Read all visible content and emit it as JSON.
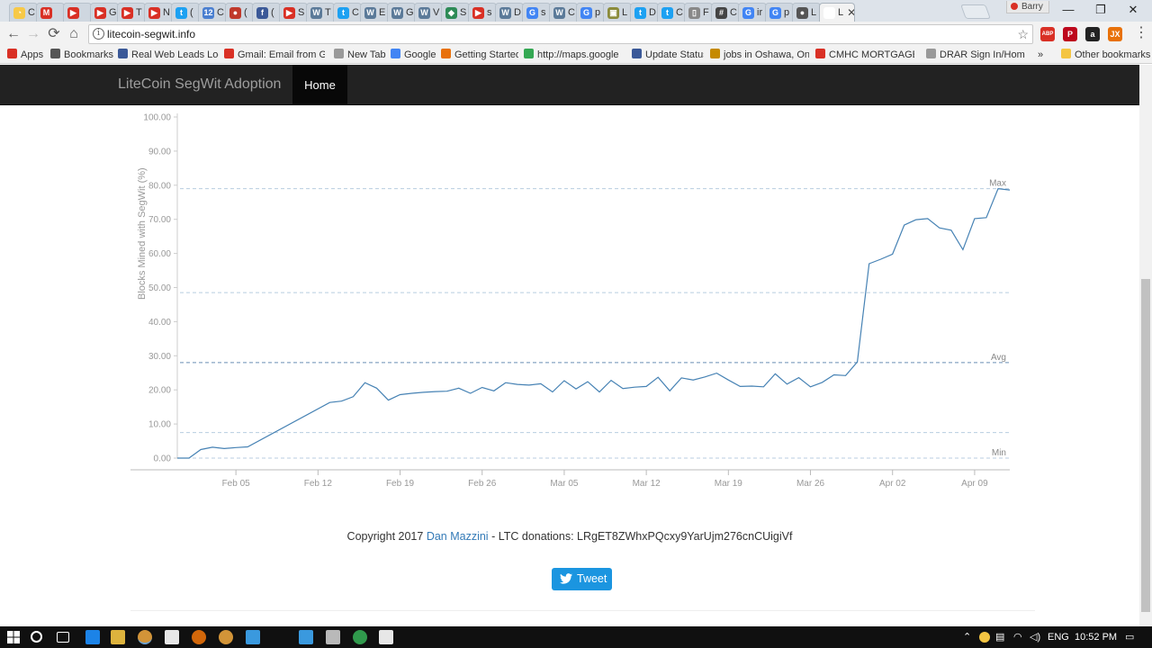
{
  "browser": {
    "tabs": [
      {
        "label": "C",
        "fav": "#f7c948",
        "glyph": "◔"
      },
      {
        "label": "",
        "fav": "#d93025",
        "glyph": "M"
      },
      {
        "label": "",
        "fav": "#d93025",
        "glyph": "▶"
      },
      {
        "label": "G",
        "fav": "#d93025",
        "glyph": "▶"
      },
      {
        "label": "T",
        "fav": "#d93025",
        "glyph": "▶"
      },
      {
        "label": "N",
        "fav": "#d93025",
        "glyph": "▶"
      },
      {
        "label": "(",
        "fav": "#1da1f2",
        "glyph": "t"
      },
      {
        "label": "C",
        "fav": "#4a7fd0",
        "glyph": "12"
      },
      {
        "label": "(",
        "fav": "#c0392b",
        "glyph": "●"
      },
      {
        "label": "(",
        "fav": "#3b5998",
        "glyph": "f"
      },
      {
        "label": "S",
        "fav": "#d93025",
        "glyph": "▶"
      },
      {
        "label": "T",
        "fav": "#5b7a99",
        "glyph": "W"
      },
      {
        "label": "C",
        "fav": "#1da1f2",
        "glyph": "t"
      },
      {
        "label": "E",
        "fav": "#5b7a99",
        "glyph": "W"
      },
      {
        "label": "G",
        "fav": "#5b7a99",
        "glyph": "W"
      },
      {
        "label": "V",
        "fav": "#5b7a99",
        "glyph": "W"
      },
      {
        "label": "S",
        "fav": "#2e8b57",
        "glyph": "◆"
      },
      {
        "label": "s",
        "fav": "#d93025",
        "glyph": "▶"
      },
      {
        "label": "D",
        "fav": "#5b7a99",
        "glyph": "W"
      },
      {
        "label": "s",
        "fav": "#4285f4",
        "glyph": "G"
      },
      {
        "label": "C",
        "fav": "#5b7a99",
        "glyph": "W"
      },
      {
        "label": "p",
        "fav": "#4285f4",
        "glyph": "G"
      },
      {
        "label": "L",
        "fav": "#8b8b3a",
        "glyph": "▣"
      },
      {
        "label": "D",
        "fav": "#1da1f2",
        "glyph": "t"
      },
      {
        "label": "C",
        "fav": "#1da1f2",
        "glyph": "t"
      },
      {
        "label": "F",
        "fav": "#888888",
        "glyph": "▯"
      },
      {
        "label": "C",
        "fav": "#444444",
        "glyph": "#"
      },
      {
        "label": "ir",
        "fav": "#4285f4",
        "glyph": "G"
      },
      {
        "label": "p",
        "fav": "#4285f4",
        "glyph": "G"
      },
      {
        "label": "L",
        "fav": "#555555",
        "glyph": "●"
      },
      {
        "label": "L",
        "fav": "#ffffff",
        "glyph": "",
        "active": true
      }
    ],
    "profile_name": "Barry",
    "url": "litecoin-segwit.info",
    "bookmarks": [
      {
        "label": "Apps",
        "color": "#d93025"
      },
      {
        "label": "Bookmarks",
        "color": "#555555"
      },
      {
        "label": "Real Web Leads Login",
        "color": "#3b5998"
      },
      {
        "label": "Gmail: Email from Goo",
        "color": "#d93025"
      },
      {
        "label": "New Tab",
        "color": "#999999"
      },
      {
        "label": "Google",
        "color": "#4285f4"
      },
      {
        "label": "Getting Started",
        "color": "#e8710a"
      },
      {
        "label": "http://maps.google.ca",
        "color": "#34a853"
      },
      {
        "label": "Update Status",
        "color": "#3b5998"
      },
      {
        "label": "jobs in Oshawa, Ontar",
        "color": "#c58a00"
      },
      {
        "label": "CMHC MORTGAGE CA",
        "color": "#d93025"
      },
      {
        "label": "DRAR Sign In/Home",
        "color": "#999999"
      },
      {
        "label": "»",
        "color": ""
      },
      {
        "label": "Other bookmarks",
        "color": "#f4c542"
      }
    ],
    "extensions": [
      {
        "name": "adblock-icon",
        "color": "#d93025",
        "glyph": "ABP"
      },
      {
        "name": "pinterest-icon",
        "color": "#bd081c",
        "glyph": "P"
      },
      {
        "name": "amazon-icon",
        "color": "#222222",
        "glyph": "a"
      },
      {
        "name": "jx-icon",
        "color": "#e8710a",
        "glyph": "JX"
      }
    ]
  },
  "site": {
    "brand": "LiteCoin SegWit Adoption",
    "nav_home": "Home",
    "footer_prefix": "Copyright 2017",
    "footer_author": "Dan Mazzini",
    "footer_suffix": " - LTC donations: LRgET8ZWhxPQcxy9YarUjm276cnCUigiVf",
    "tweet_label": "Tweet"
  },
  "chart_data": {
    "type": "line",
    "title": "",
    "xlabel": "",
    "ylabel": "Blocks Mined with SegWit (%)",
    "ylim": [
      0,
      100
    ],
    "yticks": [
      "0.00",
      "10.00",
      "20.00",
      "30.00",
      "40.00",
      "50.00",
      "60.00",
      "70.00",
      "80.00",
      "90.00",
      "100.00"
    ],
    "x_range": [
      "2017-01-31",
      "2017-04-12"
    ],
    "xticks": [
      {
        "date": "2017-02-05",
        "label": "Feb 05"
      },
      {
        "date": "2017-02-12",
        "label": "Feb 12"
      },
      {
        "date": "2017-02-19",
        "label": "Feb 19"
      },
      {
        "date": "2017-02-26",
        "label": "Feb 26"
      },
      {
        "date": "2017-03-05",
        "label": "Mar 05"
      },
      {
        "date": "2017-03-12",
        "label": "Mar 12"
      },
      {
        "date": "2017-03-19",
        "label": "Mar 19"
      },
      {
        "date": "2017-03-26",
        "label": "Mar 26"
      },
      {
        "date": "2017-04-02",
        "label": "Apr 02"
      },
      {
        "date": "2017-04-09",
        "label": "Apr 09"
      }
    ],
    "reference_lines": [
      {
        "label": "Max",
        "value": 79.0
      },
      {
        "label": "",
        "value": 48.5
      },
      {
        "label": "Avg",
        "value": 28.0
      },
      {
        "label": "",
        "value": 7.5
      },
      {
        "label": "Min",
        "value": 0.0
      }
    ],
    "color": "#4682b4",
    "series": [
      {
        "points": [
          [
            "2017-01-31",
            0.0
          ],
          [
            "2017-02-01",
            0.0
          ],
          [
            "2017-02-02",
            2.5
          ],
          [
            "2017-02-03",
            3.2
          ],
          [
            "2017-02-04",
            2.8
          ],
          [
            "2017-02-05",
            3.1
          ],
          [
            "2017-02-06",
            3.3
          ],
          [
            "2017-02-13",
            16.3
          ],
          [
            "2017-02-14",
            16.7
          ],
          [
            "2017-02-15",
            18.0
          ],
          [
            "2017-02-16",
            22.1
          ],
          [
            "2017-02-17",
            20.5
          ],
          [
            "2017-02-18",
            17.0
          ],
          [
            "2017-02-19",
            18.6
          ],
          [
            "2017-02-20",
            19.0
          ],
          [
            "2017-02-21",
            19.3
          ],
          [
            "2017-02-22",
            19.5
          ],
          [
            "2017-02-23",
            19.6
          ],
          [
            "2017-02-24",
            20.5
          ],
          [
            "2017-02-25",
            19.0
          ],
          [
            "2017-02-26",
            20.7
          ],
          [
            "2017-02-27",
            19.7
          ],
          [
            "2017-02-28",
            22.1
          ],
          [
            "2017-03-01",
            21.6
          ],
          [
            "2017-03-02",
            21.4
          ],
          [
            "2017-03-03",
            21.8
          ],
          [
            "2017-03-04",
            19.4
          ],
          [
            "2017-03-05",
            22.7
          ],
          [
            "2017-03-06",
            20.3
          ],
          [
            "2017-03-07",
            22.4
          ],
          [
            "2017-03-08",
            19.4
          ],
          [
            "2017-03-09",
            22.8
          ],
          [
            "2017-03-10",
            20.4
          ],
          [
            "2017-03-11",
            20.8
          ],
          [
            "2017-03-12",
            21.0
          ],
          [
            "2017-03-13",
            23.7
          ],
          [
            "2017-03-14",
            19.7
          ],
          [
            "2017-03-15",
            23.5
          ],
          [
            "2017-03-16",
            22.9
          ],
          [
            "2017-03-17",
            23.8
          ],
          [
            "2017-03-18",
            24.9
          ],
          [
            "2017-03-19",
            22.9
          ],
          [
            "2017-03-20",
            21.0
          ],
          [
            "2017-03-21",
            21.1
          ],
          [
            "2017-03-22",
            20.9
          ],
          [
            "2017-03-23",
            24.7
          ],
          [
            "2017-03-24",
            21.7
          ],
          [
            "2017-03-25",
            23.6
          ],
          [
            "2017-03-26",
            20.9
          ],
          [
            "2017-03-27",
            22.2
          ],
          [
            "2017-03-28",
            24.4
          ],
          [
            "2017-03-29",
            24.2
          ],
          [
            "2017-03-30",
            28.2
          ],
          [
            "2017-03-31",
            57.0
          ],
          [
            "2017-04-01",
            58.3
          ],
          [
            "2017-04-02",
            59.8
          ],
          [
            "2017-04-03",
            68.3
          ],
          [
            "2017-04-04",
            69.9
          ],
          [
            "2017-04-05",
            70.2
          ],
          [
            "2017-04-06",
            67.5
          ],
          [
            "2017-04-07",
            66.8
          ],
          [
            "2017-04-08",
            61.1
          ],
          [
            "2017-04-09",
            70.2
          ],
          [
            "2017-04-10",
            70.5
          ],
          [
            "2017-04-11",
            79.0
          ],
          [
            "2017-04-12",
            78.6
          ]
        ]
      }
    ]
  },
  "taskbar": {
    "lang": "ENG",
    "time": "10:52 PM",
    "apps": [
      {
        "name": "search-icon",
        "color": "#ffffff"
      },
      {
        "name": "task-view-icon",
        "color": "#ffffff"
      },
      {
        "name": "edge-icon",
        "color": "#1e90ff"
      },
      {
        "name": "file-explorer-icon",
        "color": "#f4c542"
      },
      {
        "name": "chrome-icon",
        "color": "#e8a33d",
        "active": true
      },
      {
        "name": "store-icon",
        "color": "#ffffff"
      },
      {
        "name": "firefox-icon",
        "color": "#e8710a"
      },
      {
        "name": "chrome-icon",
        "color": "#e8a33d"
      },
      {
        "name": "excel-icon",
        "color": "#3fa9f5"
      },
      {
        "name": "app-icon",
        "color": "#3fa9f5"
      },
      {
        "name": "app-icon",
        "color": "#cccccc"
      },
      {
        "name": "globe-icon",
        "color": "#34a853"
      },
      {
        "name": "photos-icon",
        "color": "#ffffff"
      }
    ]
  }
}
